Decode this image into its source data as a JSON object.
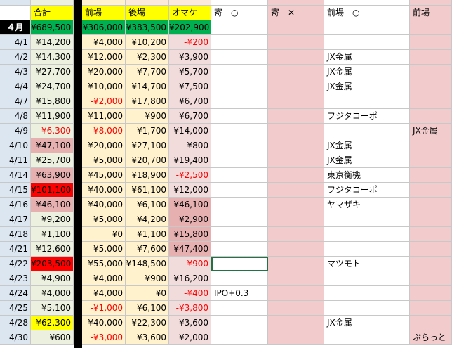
{
  "colors": {
    "date_col": "#dce6f1",
    "header_yellow": "#ffff00",
    "total_green": "#00b050",
    "total_col": "#ebf1de",
    "mae_col": "#fff2cc",
    "go_col": "#fde9d9",
    "pink_col": "#f2cccc",
    "red_fill": "#ff0000",
    "deep_fill": "#e6b0b0",
    "light_red_fill": "#f2dcdb",
    "neg_text": "#ff0000",
    "black_band": "#000000"
  },
  "header": {
    "month": "４月",
    "total": "合計",
    "mae": "前場",
    "go": "後場",
    "omake": "オマケ",
    "yori_ok": "寄　○",
    "yori_ng": "寄　✕",
    "mae_ok": "前場　○",
    "mae_last": "前場"
  },
  "totals": {
    "total": "¥689,500",
    "mae": "¥306,000",
    "go": "¥383,500",
    "omake": "¥202,900"
  },
  "rows": [
    {
      "date": "4/1",
      "total": "¥14,200",
      "mae": "¥4,000",
      "go": "¥10,200",
      "omake": "-¥200",
      "memo": "",
      "mae_ok": "",
      "mae_last": ""
    },
    {
      "date": "4/2",
      "total": "¥14,300",
      "mae": "¥12,000",
      "go": "¥2,300",
      "omake": "¥3,900",
      "memo": "",
      "mae_ok": "JX金属",
      "mae_last": ""
    },
    {
      "date": "4/3",
      "total": "¥27,700",
      "mae": "¥20,000",
      "go": "¥7,700",
      "omake": "¥5,700",
      "memo": "",
      "mae_ok": "JX金属",
      "mae_last": ""
    },
    {
      "date": "4/4",
      "total": "¥24,700",
      "mae": "¥10,000",
      "go": "¥14,700",
      "omake": "¥7,500",
      "memo": "",
      "mae_ok": "JX金属",
      "mae_last": ""
    },
    {
      "date": "4/7",
      "total": "¥15,800",
      "mae": "-¥2,000",
      "go": "¥17,800",
      "omake": "¥6,700",
      "memo": "",
      "mae_ok": "",
      "mae_last": ""
    },
    {
      "date": "4/8",
      "total": "¥11,900",
      "mae": "¥11,000",
      "go": "¥900",
      "omake": "¥6,700",
      "memo": "",
      "mae_ok": "フジタコーポ",
      "mae_last": ""
    },
    {
      "date": "4/9",
      "total": "-¥6,300",
      "mae": "-¥8,000",
      "go": "¥1,700",
      "omake": "¥14,000",
      "memo": "",
      "mae_ok": "",
      "mae_last": "JX金属"
    },
    {
      "date": "4/10",
      "total": "¥47,100",
      "mae": "¥20,000",
      "go": "¥27,100",
      "omake": "¥800",
      "memo": "",
      "mae_ok": "JX金属",
      "mae_last": ""
    },
    {
      "date": "4/11",
      "total": "¥25,700",
      "mae": "¥5,000",
      "go": "¥20,700",
      "omake": "¥19,400",
      "memo": "",
      "mae_ok": "JX金属",
      "mae_last": ""
    },
    {
      "date": "4/14",
      "total": "¥63,900",
      "mae": "¥45,000",
      "go": "¥18,900",
      "omake": "-¥2,500",
      "memo": "",
      "mae_ok": "東京衡機",
      "mae_last": ""
    },
    {
      "date": "4/15",
      "total": "¥101,100",
      "mae": "¥40,000",
      "go": "¥61,100",
      "omake": "¥12,000",
      "memo": "",
      "mae_ok": "フジタコーポ",
      "mae_last": ""
    },
    {
      "date": "4/16",
      "total": "¥46,100",
      "mae": "¥40,000",
      "go": "¥6,100",
      "omake": "¥46,100",
      "memo": "",
      "mae_ok": "ヤマザキ",
      "mae_last": ""
    },
    {
      "date": "4/17",
      "total": "¥9,200",
      "mae": "¥5,000",
      "go": "¥4,200",
      "omake": "¥2,900",
      "memo": "",
      "mae_ok": "",
      "mae_last": ""
    },
    {
      "date": "4/18",
      "total": "¥1,100",
      "mae": "¥0",
      "go": "¥1,100",
      "omake": "¥15,800",
      "memo": "",
      "mae_ok": "",
      "mae_last": ""
    },
    {
      "date": "4/21",
      "total": "¥12,600",
      "mae": "¥5,000",
      "go": "¥7,600",
      "omake": "¥47,400",
      "memo": "",
      "mae_ok": "",
      "mae_last": ""
    },
    {
      "date": "4/22",
      "total": "¥203,500",
      "mae": "¥55,000",
      "go": "¥148,500",
      "omake": "-¥900",
      "memo": "",
      "mae_ok": "マツモト",
      "mae_last": ""
    },
    {
      "date": "4/23",
      "total": "¥4,900",
      "mae": "¥4,000",
      "go": "¥900",
      "omake": "¥16,200",
      "memo": "",
      "mae_ok": "",
      "mae_last": ""
    },
    {
      "date": "4/24",
      "total": "¥4,000",
      "mae": "¥4,000",
      "go": "¥0",
      "omake": "-¥400",
      "memo": "IPO+0.3",
      "mae_ok": "",
      "mae_last": ""
    },
    {
      "date": "4/25",
      "total": "¥5,100",
      "mae": "-¥1,000",
      "go": "¥6,100",
      "omake": "-¥3,800",
      "memo": "",
      "mae_ok": "",
      "mae_last": ""
    },
    {
      "date": "4/28",
      "total": "¥62,300",
      "mae": "¥40,000",
      "go": "¥22,300",
      "omake": "¥3,600",
      "memo": "",
      "mae_ok": "JX金属",
      "mae_last": ""
    },
    {
      "date": "4/30",
      "total": "¥600",
      "mae": "-¥3,000",
      "go": "¥3,600",
      "omake": "¥2,000",
      "memo": "",
      "mae_ok": "",
      "mae_last": "ぷらっと"
    }
  ]
}
